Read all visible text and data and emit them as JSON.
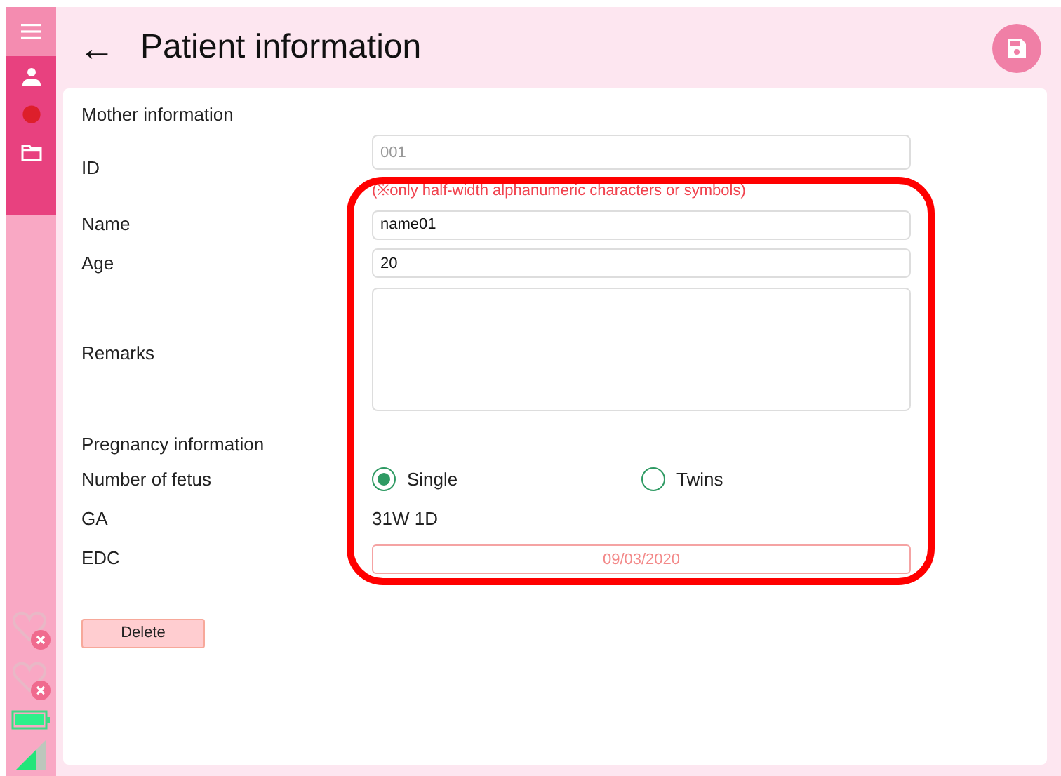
{
  "header": {
    "back": "←",
    "title": "Patient information"
  },
  "form": [
    {
      "kind": "section",
      "label": "Mother information"
    },
    {
      "kind": "text",
      "label": "ID",
      "placeholder": "001",
      "hint": "(※only half-width alphanumeric characters or symbols)"
    },
    {
      "kind": "text",
      "label": "Name",
      "value": "name01"
    },
    {
      "kind": "text",
      "label": "Age",
      "value": "20"
    },
    {
      "kind": "textarea",
      "label": "Remarks"
    },
    {
      "kind": "section",
      "label": "Pregnancy information"
    },
    {
      "kind": "radio",
      "label": "Number of fetus",
      "options": [
        {
          "label": "Single",
          "selected": true
        },
        {
          "label": "Twins",
          "selected": false
        }
      ]
    },
    {
      "kind": "value",
      "label": "GA",
      "value": "31W 1D"
    },
    {
      "kind": "date",
      "label": "EDC",
      "value": "09/03/2020"
    }
  ],
  "delete_button": "Delete"
}
